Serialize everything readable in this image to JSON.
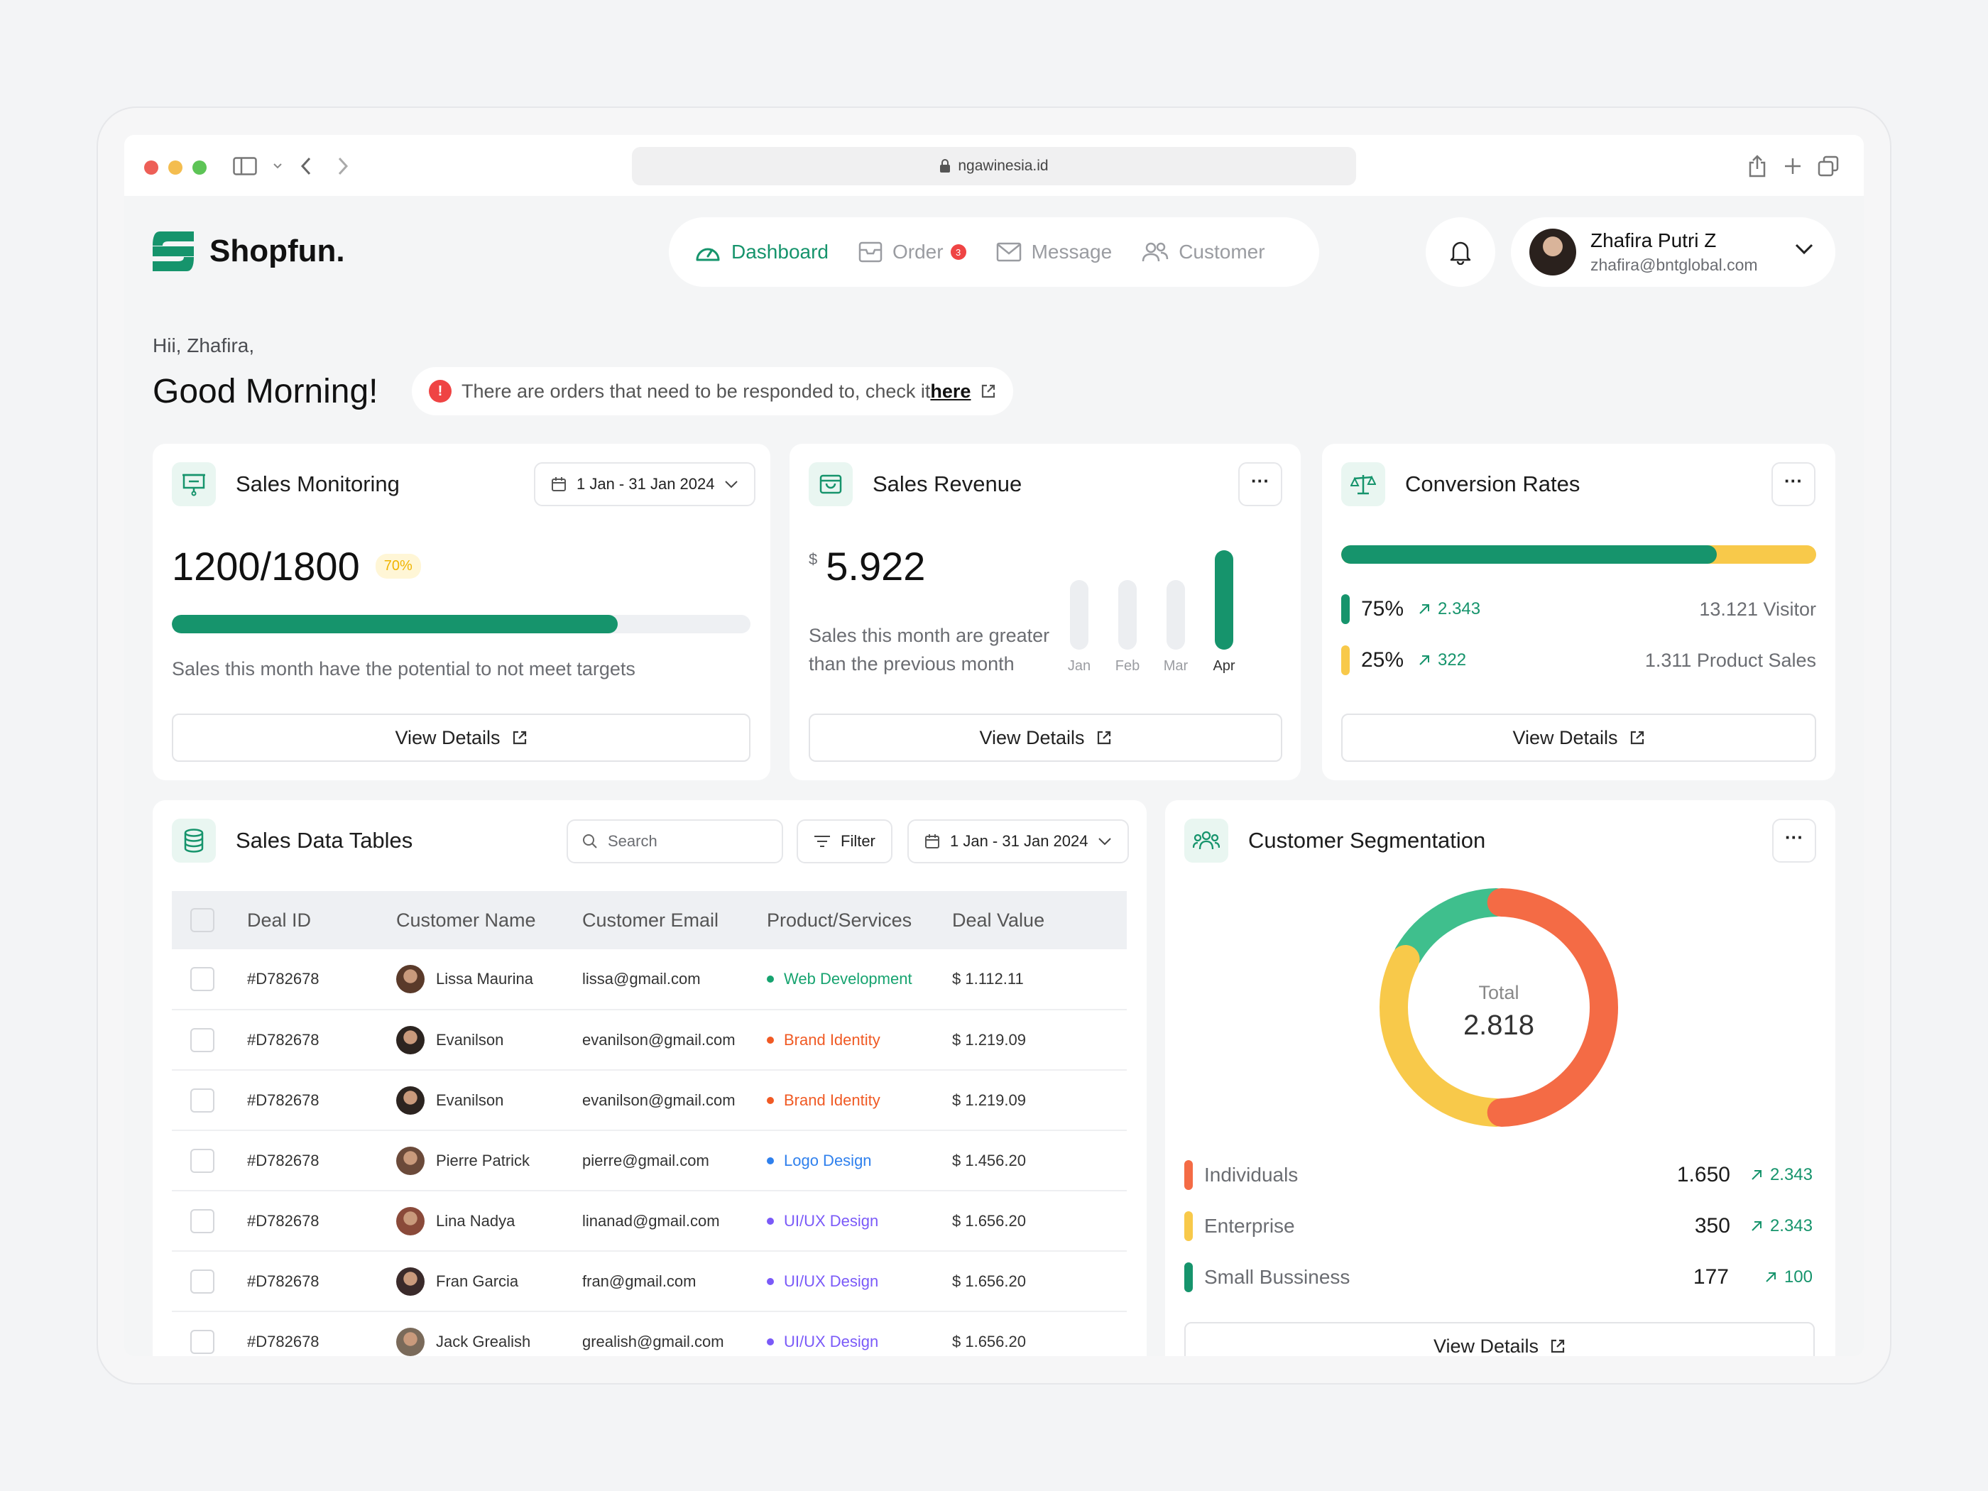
{
  "browser": {
    "url": "ngawinesia.id"
  },
  "brand": {
    "name": "Shopfun."
  },
  "nav": {
    "items": [
      {
        "label": "Dashboard",
        "icon": "gauge-icon",
        "active": true
      },
      {
        "label": "Order",
        "icon": "inbox-icon",
        "badge": "3"
      },
      {
        "label": "Message",
        "icon": "mail-icon"
      },
      {
        "label": "Customer",
        "icon": "users-icon"
      }
    ]
  },
  "user": {
    "name": "Zhafira Putri Z",
    "email": "zhafira@bntglobal.com"
  },
  "greeting": {
    "small": "Hii, Zhafira,",
    "big": "Good Morning!"
  },
  "alert": {
    "text": "There are orders that need to be responded to, check it ",
    "link": "here"
  },
  "sales_monitoring": {
    "title": "Sales Monitoring",
    "date_range": "1 Jan - 31 Jan 2024",
    "value": "1200/1800",
    "percent_label": "70%",
    "progress": 0.77,
    "note": "Sales this month have the potential to not meet targets",
    "button": "View Details"
  },
  "sales_revenue": {
    "title": "Sales Revenue",
    "currency": "$",
    "value": "5.922",
    "note_line1": "Sales this month are greater",
    "note_line2": "than the previous month",
    "button": "View Details",
    "bars": [
      {
        "label": "Jan",
        "level": 0.7
      },
      {
        "label": "Feb",
        "level": 0.7
      },
      {
        "label": "Mar",
        "level": 0.7
      },
      {
        "label": "Apr",
        "level": 1.0
      }
    ]
  },
  "conversion": {
    "title": "Conversion Rates",
    "visitor_share": 0.79,
    "rows": [
      {
        "percent": "75%",
        "delta": "2.343",
        "label": "13.121 Visitor",
        "color": "#16946c"
      },
      {
        "percent": "25%",
        "delta": "322",
        "label": "1.311 Product Sales",
        "color": "#f8c94a"
      }
    ],
    "button": "View Details"
  },
  "sales_table": {
    "title": "Sales Data Tables",
    "search_placeholder": "Search",
    "filter_label": "Filter",
    "date_range": "1 Jan - 31 Jan 2024",
    "columns": [
      "Deal ID",
      "Customer Name",
      "Customer Email",
      "Product/Services",
      "Deal Value"
    ],
    "rows": [
      {
        "id": "#D782678",
        "name": "Lissa Maurina",
        "email": "lissa@gmail.com",
        "product": "Web Development",
        "product_color": "#16a36f",
        "value": "$ 1.112.11"
      },
      {
        "id": "#D782678",
        "name": "Evanilson",
        "email": "evanilson@gmail.com",
        "product": "Brand Identity",
        "product_color": "#f05a24",
        "value": "$ 1.219.09"
      },
      {
        "id": "#D782678",
        "name": "Evanilson",
        "email": "evanilson@gmail.com",
        "product": "Brand Identity",
        "product_color": "#f05a24",
        "value": "$ 1.219.09"
      },
      {
        "id": "#D782678",
        "name": "Pierre Patrick",
        "email": "pierre@gmail.com",
        "product": "Logo Design",
        "product_color": "#2f80ed",
        "value": "$ 1.456.20"
      },
      {
        "id": "#D782678",
        "name": "Lina Nadya",
        "email": "linanad@gmail.com",
        "product": "UI/UX Design",
        "product_color": "#7a5af8",
        "value": "$ 1.656.20"
      },
      {
        "id": "#D782678",
        "name": "Fran Garcia",
        "email": "fran@gmail.com",
        "product": "UI/UX Design",
        "product_color": "#7a5af8",
        "value": "$ 1.656.20"
      },
      {
        "id": "#D782678",
        "name": "Jack Grealish",
        "email": "grealish@gmail.com",
        "product": "UI/UX Design",
        "product_color": "#7a5af8",
        "value": "$ 1.656.20"
      }
    ]
  },
  "segmentation": {
    "title": "Customer Segmentation",
    "total_label": "Total",
    "total": "2.818",
    "segments": [
      {
        "name": "Individuals",
        "value": "1.650",
        "delta": "2.343",
        "color": "#f46b45",
        "share": 0.5
      },
      {
        "name": "Enterprise",
        "value": "350",
        "delta": "2.343",
        "color": "#f8c94a",
        "share": 0.33
      },
      {
        "name": "Small Bussiness",
        "value": "177",
        "delta": "100",
        "color": "#3fbf8d",
        "share": 0.17
      }
    ],
    "button": "View Details"
  }
}
